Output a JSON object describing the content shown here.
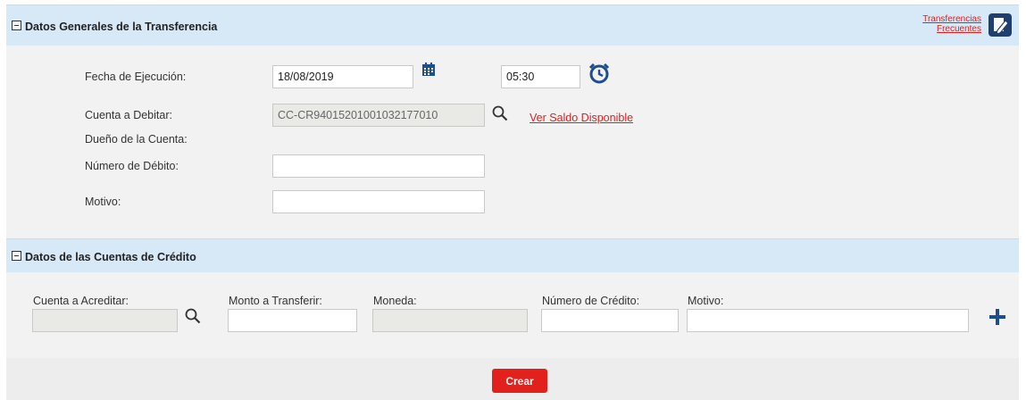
{
  "general": {
    "title": "Datos Generales de la Transferencia",
    "frequent_link_line1": "Transferencias",
    "frequent_link_line2": "Frecuentes",
    "fecha_label": "Fecha de Ejecución:",
    "fecha_value": "18/08/2019",
    "hora_value": "05:30",
    "cuenta_debitar_label": "Cuenta a Debitar:",
    "cuenta_debitar_value": "CC-CR94015201001032177010",
    "ver_saldo_link": "Ver Saldo Disponible",
    "dueno_label": "Dueño de la Cuenta:",
    "numero_debito_label": "Número de Débito:",
    "numero_debito_value": "",
    "motivo_label": "Motivo:",
    "motivo_value": ""
  },
  "credit": {
    "title": "Datos de las Cuentas de Crédito",
    "cuenta_acreditar_label": "Cuenta a Acreditar:",
    "monto_label": "Monto a Transferir:",
    "moneda_label": "Moneda:",
    "numero_credito_label": "Número de Crédito:",
    "motivo_label": "Motivo:"
  },
  "actions": {
    "create_label": "Crear"
  },
  "colors": {
    "header_bg": "#d7e8f7",
    "panel_bg": "#f2f2f2",
    "accent_red": "#e3211c",
    "icon_blue": "#1f4e8c"
  },
  "icons": [
    "collapse-icon",
    "edit-document-icon",
    "calendar-icon",
    "alarm-clock-icon",
    "search-icon",
    "add-icon"
  ]
}
